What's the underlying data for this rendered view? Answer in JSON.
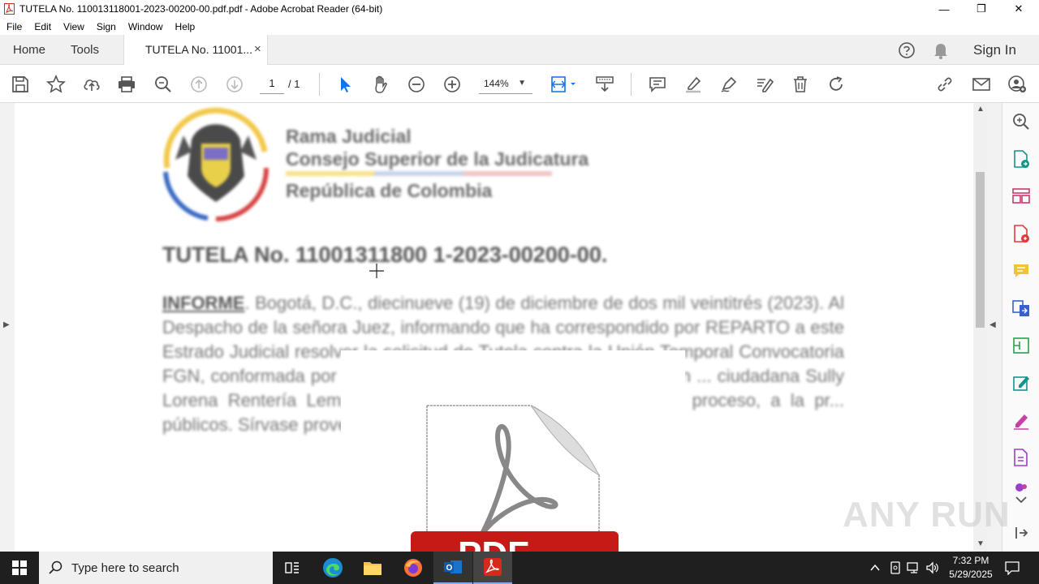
{
  "window": {
    "title": "TUTELA No. 110013118001-2023-00200-00.pdf.pdf - Adobe Acrobat Reader (64-bit)",
    "minimize": "—",
    "maximize": "❐",
    "close": "✕"
  },
  "menu": [
    "File",
    "Edit",
    "View",
    "Sign",
    "Window",
    "Help"
  ],
  "tabs": {
    "home": "Home",
    "tools": "Tools",
    "document": "TUTELA No. 11001...",
    "close": "×",
    "sign_in": "Sign In"
  },
  "toolbar": {
    "page_current": "1",
    "page_total": "/ 1",
    "zoom": "144%"
  },
  "document": {
    "header_line1": "Rama Judicial",
    "header_line2": "Consejo Superior de la Judicatura",
    "header_line3": "República de Colombia",
    "case_title": "TUTELA No. 11001311800 1-2023-00200-00.",
    "informe_label": "INFORME",
    "paragraph": ". Bogotá, D.C., diecinueve (19) de diciembre de dos mil veintitrés (2023). Al Despacho de la señora Juez, informando que ha correspondido por REPARTO a este Estrado Judicial resolver la solicitud de Tutela contra la Unión Temporal Convocatoria FGN, conformada por ... S.A.S. y la Fiscalía General de la Nación ... ciudadana Sully Lorena Rentería Lemus, por ... iguales a la igualdad, debido proceso, a la pr... públicos. Sírvase proveer.",
    "pdf_overlay_text": "PDF"
  },
  "taskbar": {
    "search_placeholder": "Type here to search",
    "time": "7:32 PM",
    "date": "5/29/2025"
  },
  "watermark": "ANY RUN",
  "colors": {
    "acrobat_red": "#d7281e",
    "select_blue": "#1473e6",
    "taskbar": "#1f1f1f"
  }
}
